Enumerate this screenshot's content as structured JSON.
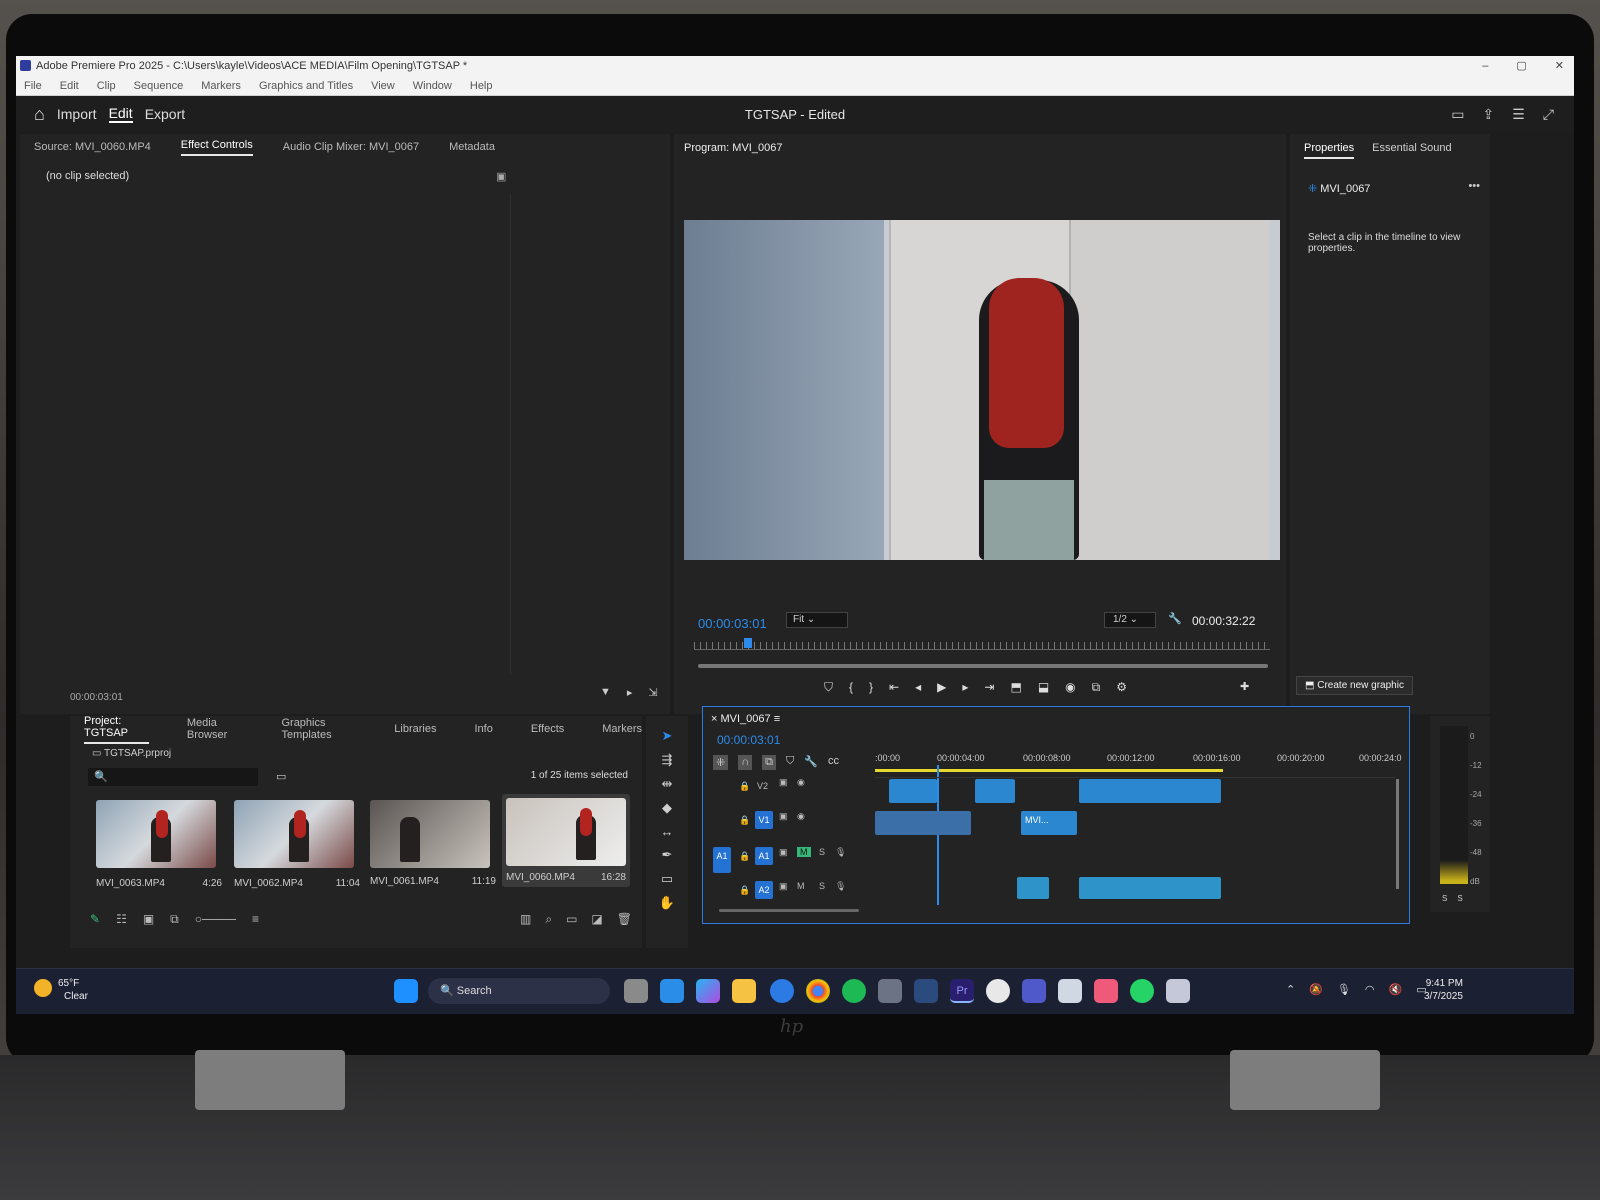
{
  "window": {
    "title": "Adobe Premiere Pro 2025 - C:\\Users\\kayle\\Videos\\ACE MEDIA\\Film Opening\\TGTSAP *"
  },
  "menu": [
    "File",
    "Edit",
    "Clip",
    "Sequence",
    "Markers",
    "Graphics and Titles",
    "View",
    "Window",
    "Help"
  ],
  "header": {
    "import": "Import",
    "edit": "Edit",
    "export": "Export",
    "project_title": "TGTSAP - Edited"
  },
  "source_panel": {
    "tabs": [
      "Source: MVI_0060.MP4",
      "Effect Controls",
      "Audio Clip Mixer: MVI_0067",
      "Metadata"
    ],
    "active_tab": "Effect Controls",
    "empty_msg": "(no clip selected)",
    "timecode": "00:00:03:01"
  },
  "program": {
    "tab": "Program: MVI_0067",
    "timecode": "00:00:03:01",
    "fit": "Fit",
    "resolution": "1/2",
    "duration": "00:00:32:22"
  },
  "properties": {
    "tabs": [
      "Properties",
      "Essential Sound"
    ],
    "clip_name": "MVI_0067",
    "hint": "Select a clip in the timeline to view properties.",
    "create_graphic": "Create new graphic"
  },
  "project": {
    "tabs": [
      "Project: TGTSAP",
      "Media Browser",
      "Graphics Templates",
      "Libraries",
      "Info",
      "Effects",
      "Markers"
    ],
    "file": "TGTSAP.prproj",
    "selection": "1 of 25 items selected",
    "items": [
      {
        "name": "MVI_0063.MP4",
        "duration": "4:26"
      },
      {
        "name": "MVI_0062.MP4",
        "duration": "11:04"
      },
      {
        "name": "MVI_0061.MP4",
        "duration": "11:19"
      },
      {
        "name": "MVI_0060.MP4",
        "duration": "16:28"
      }
    ]
  },
  "timeline": {
    "tab": "MVI_0067",
    "timecode": "00:00:03:01",
    "ruler": [
      ":00:00",
      "00:00:04:00",
      "00:00:08:00",
      "00:00:12:00",
      "00:00:16:00",
      "00:00:20:00",
      "00:00:24:0"
    ],
    "tracks": [
      "V2",
      "V1",
      "A1",
      "A2"
    ],
    "clip_label": "MVI..."
  },
  "meter": {
    "scale": [
      "0",
      "-12",
      "-24",
      "-36",
      "-48",
      "dB"
    ],
    "channels": [
      "S",
      "S"
    ]
  },
  "taskbar": {
    "weather_temp": "65°F",
    "weather_desc": "Clear",
    "search": "Search",
    "time": "9:41 PM",
    "date": "3/7/2025",
    "notif": "3"
  }
}
